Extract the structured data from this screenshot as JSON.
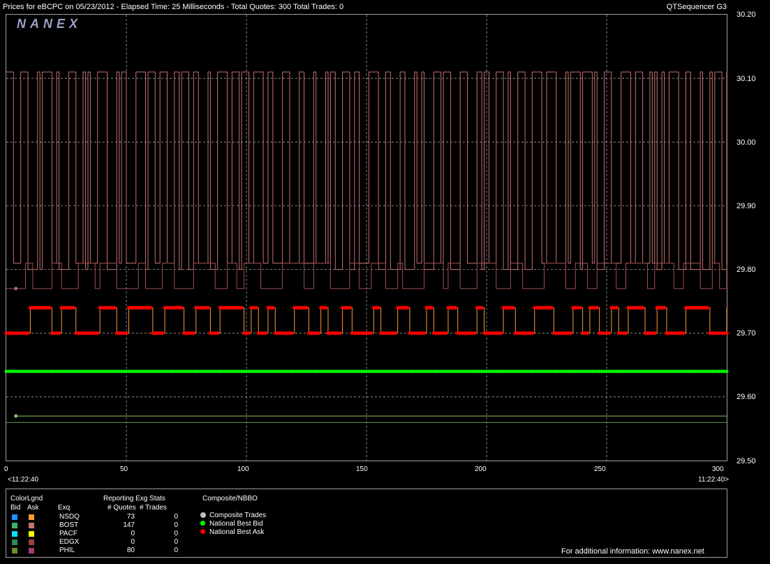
{
  "header": {
    "title": "Prices for  eBCPC  on  05/23/2012  -  Elapsed Time: 25 Milliseconds  -  Total Quotes: 300  Total Trades: 0",
    "app_name": "QTSequencer G3"
  },
  "logo": "NANEX",
  "time_start": "<11:22:40",
  "time_end": "11:22:40>",
  "colors": {
    "bost_ask": "#c87070",
    "nsdq_ask": "#ff9a30",
    "best_ask": "#ff0000",
    "best_bid": "#00ff00",
    "grid": "#c0c0c0",
    "phil_bid": "#8cc060"
  },
  "chart_data": {
    "type": "line",
    "title": "",
    "xlabel": "",
    "ylabel": "",
    "xlim": [
      0,
      300
    ],
    "ylim": [
      29.5,
      30.2
    ],
    "x_ticks": [
      "0",
      "50",
      "100",
      "150",
      "200",
      "250",
      "300"
    ],
    "y_ticks": [
      "30.20",
      "30.10",
      "30.00",
      "29.90",
      "29.80",
      "29.70",
      "29.60",
      "29.50"
    ],
    "grid": true,
    "series": [
      {
        "name": "BOST",
        "kind": "ask",
        "levels": [
          30.11,
          29.81,
          29.8,
          29.77
        ],
        "color": "#c87070"
      },
      {
        "name": "NSDQ",
        "kind": "ask",
        "levels": [
          29.74,
          29.7
        ],
        "color": "#ff9a30"
      },
      {
        "name": "National Best Ask",
        "levels": [
          29.74,
          29.7
        ],
        "color": "#ff0000"
      },
      {
        "name": "National Best Bid",
        "levels": [
          29.64
        ],
        "color": "#00ff00"
      },
      {
        "name": "PHIL",
        "kind": "bid",
        "levels": [
          29.57,
          29.56
        ],
        "color": "#8cc060"
      }
    ]
  },
  "legend": {
    "colorlgnd_label": "ColorLgnd",
    "bid_header": "Bid",
    "ask_header": "Ask",
    "exq_header": "Exq",
    "stats_title": "Reporting Exg Stats",
    "quotes_header": "# Quotes",
    "trades_header": "# Trades",
    "composite_title": "Composite/NBBO",
    "exchanges": [
      {
        "name": "NSDQ",
        "quotes": "73",
        "trades": "0",
        "bid_color": "#1e90ff",
        "ask_color": "#ff9a30"
      },
      {
        "name": "BOST",
        "quotes": "147",
        "trades": "0",
        "bid_color": "#3cb371",
        "ask_color": "#c87070"
      },
      {
        "name": "PACF",
        "quotes": "0",
        "trades": "0",
        "bid_color": "#00e5ff",
        "ask_color": "#ffff00"
      },
      {
        "name": "EDGX",
        "quotes": "0",
        "trades": "0",
        "bid_color": "#2e8b57",
        "ask_color": "#a04040"
      },
      {
        "name": "PHIL",
        "quotes": "80",
        "trades": "0",
        "bid_color": "#6b8e23",
        "ask_color": "#a03c6e"
      }
    ],
    "composite_items": [
      {
        "label": "Composite Trades",
        "color": "#c0c0c0"
      },
      {
        "label": "National Best Bid",
        "color": "#00ff00"
      },
      {
        "label": "National Best Ask",
        "color": "#ff0000"
      }
    ],
    "footer": "For additional information: www.nanex.net"
  }
}
